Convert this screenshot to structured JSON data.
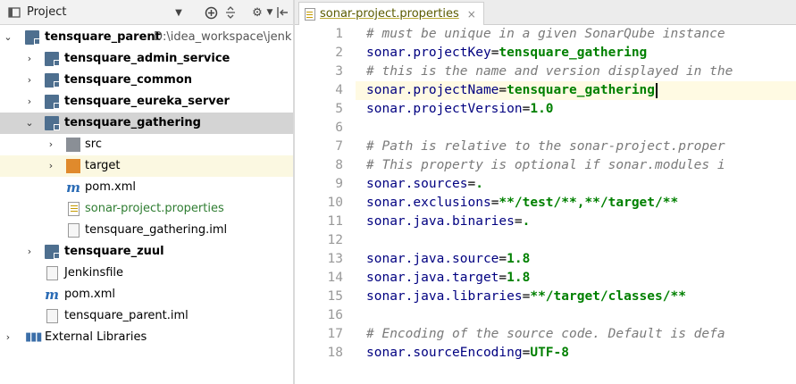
{
  "project_panel": {
    "title": "Project",
    "toolbar_icons": [
      "dropdown-icon",
      "locate-icon",
      "collapse-icon",
      "settings-icon",
      "hide-icon"
    ],
    "tree": [
      {
        "label": "tensquare_parent",
        "extra": "D:\\idea_workspace\\jenk",
        "icon": "module-folder-icon",
        "expanded": true
      },
      {
        "label": "tensquare_admin_service",
        "icon": "module-folder-icon",
        "expanded": false
      },
      {
        "label": "tensquare_common",
        "icon": "module-folder-icon",
        "expanded": false
      },
      {
        "label": "tensquare_eureka_server",
        "icon": "module-folder-icon",
        "expanded": false
      },
      {
        "label": "tensquare_gathering",
        "icon": "module-folder-icon",
        "expanded": true,
        "selected": true
      },
      {
        "label": "src",
        "icon": "folder-icon",
        "expanded": false
      },
      {
        "label": "target",
        "icon": "folder-icon",
        "expanded": false
      },
      {
        "label": "pom.xml",
        "icon": "maven-icon"
      },
      {
        "label": "sonar-project.properties",
        "icon": "properties-file-icon"
      },
      {
        "label": "tensquare_gathering.iml",
        "icon": "iml-file-icon"
      },
      {
        "label": "tensquare_zuul",
        "icon": "module-folder-icon",
        "expanded": false
      },
      {
        "label": "Jenkinsfile",
        "icon": "file-icon"
      },
      {
        "label": "pom.xml",
        "icon": "maven-icon"
      },
      {
        "label": "tensquare_parent.iml",
        "icon": "iml-file-icon"
      },
      {
        "label": "External Libraries",
        "icon": "library-icon",
        "expanded": false
      }
    ]
  },
  "editor": {
    "tab_label": "sonar-project.properties",
    "tab_close": "×",
    "lines": [
      {
        "n": "1",
        "comment": "# must be unique in a given SonarQube instance"
      },
      {
        "n": "2",
        "key": "sonar.projectKey",
        "value": "tensquare_gathering"
      },
      {
        "n": "3",
        "comment": "# this is the name and version displayed in the"
      },
      {
        "n": "4",
        "key": "sonar.projectName",
        "value": "tensquare_gathering"
      },
      {
        "n": "5",
        "key": "sonar.projectVersion",
        "value": "1.0"
      },
      {
        "n": "6"
      },
      {
        "n": "7",
        "comment": "# Path is relative to the sonar-project.proper"
      },
      {
        "n": "8",
        "comment": "# This property is optional if sonar.modules i"
      },
      {
        "n": "9",
        "key": "sonar.sources",
        "value": "."
      },
      {
        "n": "10",
        "key": "sonar.exclusions",
        "value": "**/test/**,**/target/**"
      },
      {
        "n": "11",
        "key": "sonar.java.binaries",
        "value": "."
      },
      {
        "n": "12"
      },
      {
        "n": "13",
        "key": "sonar.java.source",
        "value": "1.8"
      },
      {
        "n": "14",
        "key": "sonar.java.target",
        "value": "1.8"
      },
      {
        "n": "15",
        "key": "sonar.java.libraries",
        "value": "**/target/classes/**"
      },
      {
        "n": "16"
      },
      {
        "n": "17",
        "comment": "# Encoding of the source code. Default is defa"
      },
      {
        "n": "18",
        "key": "sonar.sourceEncoding",
        "value": "UTF-8"
      }
    ]
  }
}
